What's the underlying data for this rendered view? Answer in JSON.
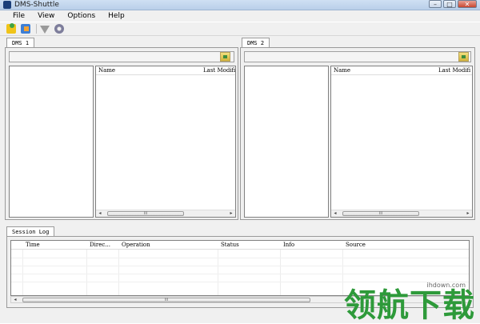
{
  "window": {
    "title": "DMS-Shuttle"
  },
  "menu": [
    "File",
    "View",
    "Options",
    "Help"
  ],
  "panes": [
    {
      "tab": "DMS 1",
      "columns": [
        "Name",
        "Last Modifi"
      ]
    },
    {
      "tab": "DMS 2",
      "columns": [
        "Name",
        "Last Modifi"
      ]
    }
  ],
  "session_log": {
    "tab": "Session Log",
    "columns": [
      "Time",
      "Direc...",
      "Operation",
      "Status",
      "Info",
      "Source"
    ]
  },
  "scroll_thumb_glyph": "III",
  "watermark": {
    "text": "领航下载",
    "url": "ihdown.com"
  }
}
